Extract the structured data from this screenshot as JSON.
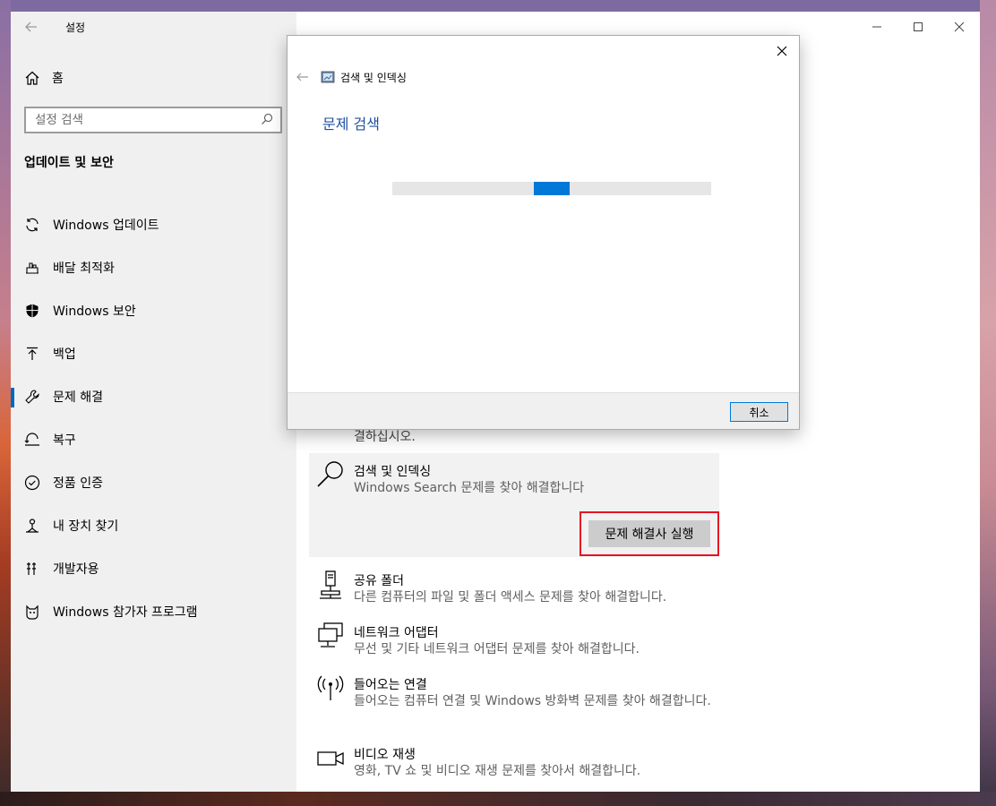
{
  "window": {
    "title": "설정"
  },
  "sidebar": {
    "home_label": "홈",
    "search_placeholder": "설정 검색",
    "section_title": "업데이트 및 보안",
    "items": [
      {
        "label": "Windows 업데이트",
        "icon": "sync-icon",
        "active": false
      },
      {
        "label": "배달 최적화",
        "icon": "delivery-icon",
        "active": false
      },
      {
        "label": "Windows 보안",
        "icon": "shield-icon",
        "active": false
      },
      {
        "label": "백업",
        "icon": "backup-arrow-icon",
        "active": false
      },
      {
        "label": "문제 해결",
        "icon": "wrench-icon",
        "active": true
      },
      {
        "label": "복구",
        "icon": "recovery-icon",
        "active": false
      },
      {
        "label": "정품 인증",
        "icon": "check-circle-icon",
        "active": false
      },
      {
        "label": "내 장치 찾기",
        "icon": "find-device-icon",
        "active": false
      },
      {
        "label": "개발자용",
        "icon": "developer-tools-icon",
        "active": false
      },
      {
        "label": "Windows 참가자 프로그램",
        "icon": "insider-icon",
        "active": false
      }
    ]
  },
  "main": {
    "partial_text": "결하십시오.",
    "troubleshooters": [
      {
        "title": "검색 및 인덱싱",
        "desc": "Windows Search 문제를 찾아 해결합니다",
        "icon": "search-icon",
        "expanded": true,
        "run_label": "문제 해결사 실행"
      },
      {
        "title": "공유 폴더",
        "desc": "다른 컴퓨터의 파일 및 폴더 액세스 문제를 찾아 해결합니다.",
        "icon": "shared-folder-icon"
      },
      {
        "title": "네트워크 어댑터",
        "desc": "무선 및 기타 네트워크 어댑터 문제를 찾아 해결합니다.",
        "icon": "network-adapter-icon"
      },
      {
        "title": "들어오는 연결",
        "desc": "들어오는 컴퓨터 연결 및 Windows 방화벽 문제를 찾아 해결합니다.",
        "icon": "incoming-antenna-icon"
      },
      {
        "title": "비디오 재생",
        "desc": "영화, TV 쇼 및 비디오 재생 문제를 찾아서 해결합니다.",
        "icon": "video-camera-icon"
      }
    ]
  },
  "dialog": {
    "app_title": "검색 및 인덱싱",
    "heading": "문제 검색",
    "progress": 0.5,
    "cancel_label": "취소"
  },
  "colors": {
    "accent": "#0078d7",
    "highlight": "#e81123"
  }
}
